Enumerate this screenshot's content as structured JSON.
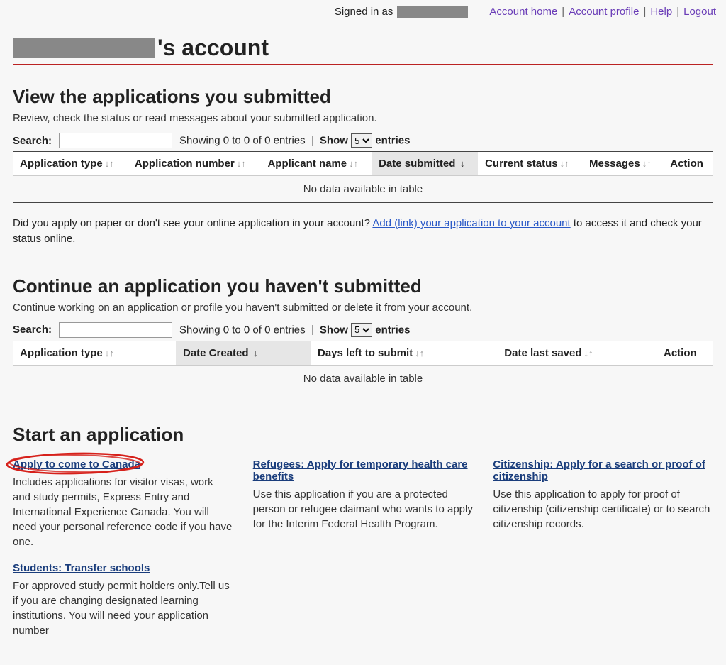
{
  "topbar": {
    "signed_in_label": "Signed in as",
    "links": {
      "home": "Account home",
      "profile": "Account profile",
      "help": "Help",
      "logout": "Logout"
    }
  },
  "page_title_suffix": "'s account",
  "section1": {
    "heading": "View the applications you submitted",
    "subtext": "Review, check the status or read messages about your submitted application.",
    "search_label": "Search:",
    "showing_text": "Showing 0 to 0 of 0 entries",
    "show_label": "Show",
    "entries_label": "entries",
    "entries_selected": "5",
    "columns": {
      "app_type": "Application type",
      "app_number": "Application number",
      "applicant": "Applicant name",
      "date_submitted": "Date submitted",
      "status": "Current status",
      "messages": "Messages",
      "action": "Action"
    },
    "no_data": "No data available in table",
    "after_text_1": "Did you apply on paper or don't see your online application in your account?  ",
    "after_link": "Add (link) your application to your account",
    "after_text_2": " to access it and check your status online."
  },
  "section2": {
    "heading": "Continue an application you haven't submitted",
    "subtext": "Continue working on an application or profile you haven't submitted or delete it from your account.",
    "search_label": "Search:",
    "showing_text": "Showing 0 to 0 of 0 entries",
    "show_label": "Show",
    "entries_label": "entries",
    "entries_selected": "5",
    "columns": {
      "app_type": "Application type",
      "date_created": "Date Created",
      "days_left": "Days left to submit",
      "date_saved": "Date last saved",
      "action": "Action"
    },
    "no_data": "No data available in table"
  },
  "section3": {
    "heading": "Start an application",
    "items": {
      "apply": {
        "title": "Apply to come to Canada",
        "desc": "Includes applications for visitor visas, work and study permits, Express Entry and International Experience Canada. You will need your personal reference code if you have one."
      },
      "refugees": {
        "title": "Refugees: Apply for temporary health care benefits",
        "desc": "Use this application if you are a protected person or refugee claimant who wants to apply for the Interim Federal Health Program."
      },
      "citizenship": {
        "title": "Citizenship: Apply for a search or proof of citizenship ",
        "desc": "Use this application to apply for proof of citizenship (citizenship certificate) or to search citizenship records."
      },
      "students": {
        "title": "Students: Transfer schools",
        "desc": "For approved study permit holders only.Tell us if you are changing designated learning institutions. You will need your application number"
      }
    }
  }
}
